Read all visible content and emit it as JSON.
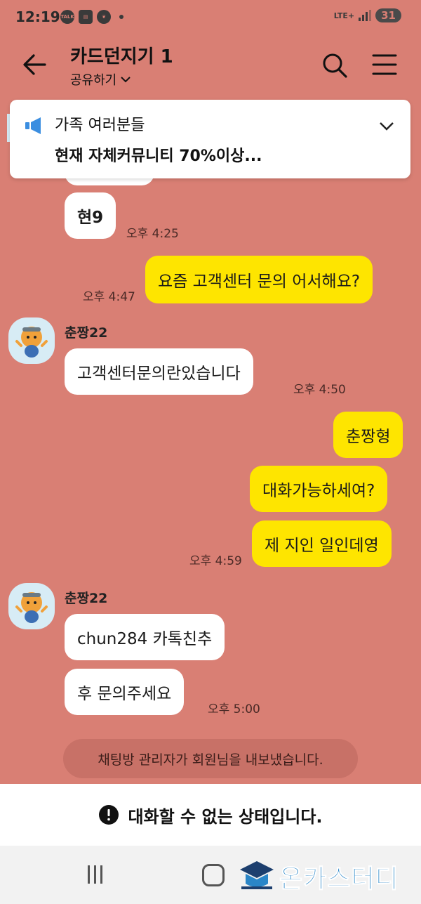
{
  "status_bar": {
    "time": "12:19",
    "network": "LTE+",
    "battery": "31",
    "icons": [
      "talk-icon",
      "news-icon",
      "leaf-icon",
      "dot-icon"
    ]
  },
  "header": {
    "title": "카드던지기 1",
    "share_label": "공유하기",
    "icons": [
      "back-arrow-icon",
      "search-icon",
      "menu-icon"
    ]
  },
  "notice": {
    "title": "가족 여러분들",
    "body": "현재 자체커뮤니티 70%이상...",
    "icon": "megaphone-icon"
  },
  "messages": {
    "m1": {
      "text": "현9",
      "time": "오후 4:25"
    },
    "m2": {
      "text": "요즘 고객센터 문의 어서해요?",
      "time": "오후 4:47"
    },
    "m3_sender": "춘짱22",
    "m3": {
      "text": "고객센터문의란있습니다",
      "time": "오후 4:50"
    },
    "m4": {
      "text": "춘짱형"
    },
    "m5": {
      "text": "대화가능하세여?"
    },
    "m6": {
      "text": "제 지인 일인데영",
      "time": "오후 4:59"
    },
    "m7_sender": "춘짱22",
    "m7": {
      "text": "chun284 카톡친추"
    },
    "m8": {
      "text": "후 문의주세요",
      "time": "오후 5:00"
    }
  },
  "system_message": "채팅방 관리자가 회원님을 내보냈습니다.",
  "footer": {
    "text": "대화할 수 없는 상태입니다.",
    "icon": "alert-icon"
  },
  "watermark": {
    "text": "온카스터디"
  },
  "colors": {
    "background": "#d97f74",
    "incoming_bubble": "#ffffff",
    "outgoing_bubble": "#fee500",
    "accent_blue": "#2a86c8"
  }
}
